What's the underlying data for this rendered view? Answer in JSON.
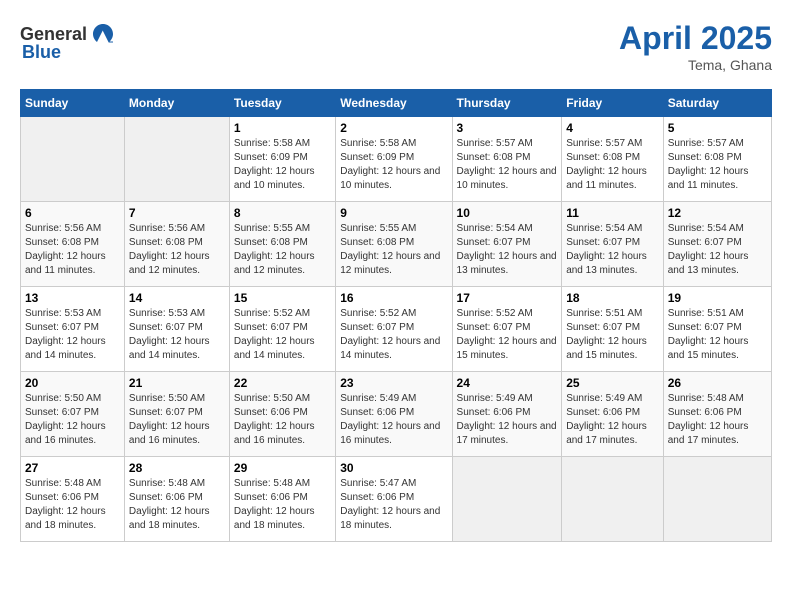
{
  "header": {
    "logo_general": "General",
    "logo_blue": "Blue",
    "month_title": "April 2025",
    "location": "Tema, Ghana"
  },
  "days_of_week": [
    "Sunday",
    "Monday",
    "Tuesday",
    "Wednesday",
    "Thursday",
    "Friday",
    "Saturday"
  ],
  "weeks": [
    [
      {
        "num": "",
        "sunrise": "",
        "sunset": "",
        "daylight": "",
        "empty": true
      },
      {
        "num": "",
        "sunrise": "",
        "sunset": "",
        "daylight": "",
        "empty": true
      },
      {
        "num": "1",
        "sunrise": "Sunrise: 5:58 AM",
        "sunset": "Sunset: 6:09 PM",
        "daylight": "Daylight: 12 hours and 10 minutes.",
        "empty": false
      },
      {
        "num": "2",
        "sunrise": "Sunrise: 5:58 AM",
        "sunset": "Sunset: 6:09 PM",
        "daylight": "Daylight: 12 hours and 10 minutes.",
        "empty": false
      },
      {
        "num": "3",
        "sunrise": "Sunrise: 5:57 AM",
        "sunset": "Sunset: 6:08 PM",
        "daylight": "Daylight: 12 hours and 10 minutes.",
        "empty": false
      },
      {
        "num": "4",
        "sunrise": "Sunrise: 5:57 AM",
        "sunset": "Sunset: 6:08 PM",
        "daylight": "Daylight: 12 hours and 11 minutes.",
        "empty": false
      },
      {
        "num": "5",
        "sunrise": "Sunrise: 5:57 AM",
        "sunset": "Sunset: 6:08 PM",
        "daylight": "Daylight: 12 hours and 11 minutes.",
        "empty": false
      }
    ],
    [
      {
        "num": "6",
        "sunrise": "Sunrise: 5:56 AM",
        "sunset": "Sunset: 6:08 PM",
        "daylight": "Daylight: 12 hours and 11 minutes.",
        "empty": false
      },
      {
        "num": "7",
        "sunrise": "Sunrise: 5:56 AM",
        "sunset": "Sunset: 6:08 PM",
        "daylight": "Daylight: 12 hours and 12 minutes.",
        "empty": false
      },
      {
        "num": "8",
        "sunrise": "Sunrise: 5:55 AM",
        "sunset": "Sunset: 6:08 PM",
        "daylight": "Daylight: 12 hours and 12 minutes.",
        "empty": false
      },
      {
        "num": "9",
        "sunrise": "Sunrise: 5:55 AM",
        "sunset": "Sunset: 6:08 PM",
        "daylight": "Daylight: 12 hours and 12 minutes.",
        "empty": false
      },
      {
        "num": "10",
        "sunrise": "Sunrise: 5:54 AM",
        "sunset": "Sunset: 6:07 PM",
        "daylight": "Daylight: 12 hours and 13 minutes.",
        "empty": false
      },
      {
        "num": "11",
        "sunrise": "Sunrise: 5:54 AM",
        "sunset": "Sunset: 6:07 PM",
        "daylight": "Daylight: 12 hours and 13 minutes.",
        "empty": false
      },
      {
        "num": "12",
        "sunrise": "Sunrise: 5:54 AM",
        "sunset": "Sunset: 6:07 PM",
        "daylight": "Daylight: 12 hours and 13 minutes.",
        "empty": false
      }
    ],
    [
      {
        "num": "13",
        "sunrise": "Sunrise: 5:53 AM",
        "sunset": "Sunset: 6:07 PM",
        "daylight": "Daylight: 12 hours and 14 minutes.",
        "empty": false
      },
      {
        "num": "14",
        "sunrise": "Sunrise: 5:53 AM",
        "sunset": "Sunset: 6:07 PM",
        "daylight": "Daylight: 12 hours and 14 minutes.",
        "empty": false
      },
      {
        "num": "15",
        "sunrise": "Sunrise: 5:52 AM",
        "sunset": "Sunset: 6:07 PM",
        "daylight": "Daylight: 12 hours and 14 minutes.",
        "empty": false
      },
      {
        "num": "16",
        "sunrise": "Sunrise: 5:52 AM",
        "sunset": "Sunset: 6:07 PM",
        "daylight": "Daylight: 12 hours and 14 minutes.",
        "empty": false
      },
      {
        "num": "17",
        "sunrise": "Sunrise: 5:52 AM",
        "sunset": "Sunset: 6:07 PM",
        "daylight": "Daylight: 12 hours and 15 minutes.",
        "empty": false
      },
      {
        "num": "18",
        "sunrise": "Sunrise: 5:51 AM",
        "sunset": "Sunset: 6:07 PM",
        "daylight": "Daylight: 12 hours and 15 minutes.",
        "empty": false
      },
      {
        "num": "19",
        "sunrise": "Sunrise: 5:51 AM",
        "sunset": "Sunset: 6:07 PM",
        "daylight": "Daylight: 12 hours and 15 minutes.",
        "empty": false
      }
    ],
    [
      {
        "num": "20",
        "sunrise": "Sunrise: 5:50 AM",
        "sunset": "Sunset: 6:07 PM",
        "daylight": "Daylight: 12 hours and 16 minutes.",
        "empty": false
      },
      {
        "num": "21",
        "sunrise": "Sunrise: 5:50 AM",
        "sunset": "Sunset: 6:07 PM",
        "daylight": "Daylight: 12 hours and 16 minutes.",
        "empty": false
      },
      {
        "num": "22",
        "sunrise": "Sunrise: 5:50 AM",
        "sunset": "Sunset: 6:06 PM",
        "daylight": "Daylight: 12 hours and 16 minutes.",
        "empty": false
      },
      {
        "num": "23",
        "sunrise": "Sunrise: 5:49 AM",
        "sunset": "Sunset: 6:06 PM",
        "daylight": "Daylight: 12 hours and 16 minutes.",
        "empty": false
      },
      {
        "num": "24",
        "sunrise": "Sunrise: 5:49 AM",
        "sunset": "Sunset: 6:06 PM",
        "daylight": "Daylight: 12 hours and 17 minutes.",
        "empty": false
      },
      {
        "num": "25",
        "sunrise": "Sunrise: 5:49 AM",
        "sunset": "Sunset: 6:06 PM",
        "daylight": "Daylight: 12 hours and 17 minutes.",
        "empty": false
      },
      {
        "num": "26",
        "sunrise": "Sunrise: 5:48 AM",
        "sunset": "Sunset: 6:06 PM",
        "daylight": "Daylight: 12 hours and 17 minutes.",
        "empty": false
      }
    ],
    [
      {
        "num": "27",
        "sunrise": "Sunrise: 5:48 AM",
        "sunset": "Sunset: 6:06 PM",
        "daylight": "Daylight: 12 hours and 18 minutes.",
        "empty": false
      },
      {
        "num": "28",
        "sunrise": "Sunrise: 5:48 AM",
        "sunset": "Sunset: 6:06 PM",
        "daylight": "Daylight: 12 hours and 18 minutes.",
        "empty": false
      },
      {
        "num": "29",
        "sunrise": "Sunrise: 5:48 AM",
        "sunset": "Sunset: 6:06 PM",
        "daylight": "Daylight: 12 hours and 18 minutes.",
        "empty": false
      },
      {
        "num": "30",
        "sunrise": "Sunrise: 5:47 AM",
        "sunset": "Sunset: 6:06 PM",
        "daylight": "Daylight: 12 hours and 18 minutes.",
        "empty": false
      },
      {
        "num": "",
        "sunrise": "",
        "sunset": "",
        "daylight": "",
        "empty": true
      },
      {
        "num": "",
        "sunrise": "",
        "sunset": "",
        "daylight": "",
        "empty": true
      },
      {
        "num": "",
        "sunrise": "",
        "sunset": "",
        "daylight": "",
        "empty": true
      }
    ]
  ]
}
